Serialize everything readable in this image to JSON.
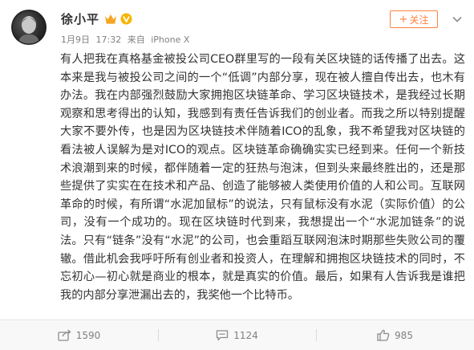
{
  "author": {
    "name": "徐小平",
    "post_date": "1月9日",
    "post_time": "17:32",
    "source_prefix": "来自",
    "source_device": "iPhone X"
  },
  "header": {
    "follow_label": "关注",
    "follow_plus": "+"
  },
  "post": {
    "text": "有人把我在真格基金被投公司CEO群里写的一段有关区块链的话传播了出去。这本来是我与被投公司之间的一个“低调”内部分享，现在被人擅自传出去，也木有办法。我在内部强烈鼓励大家拥抱区块链革命、学习区块链技术，是我经过长期观察和思考得出的认知，我感到有责任告诉我们的创业者。而我之所以特别提醒大家不要外传，也是因为区块链技术伴随着ICO的乱象，我不希望我对区块链的看法被人误解为是对ICO的观点。区块链革命确确实实已经到来。任何一个新技术浪潮到来的时候，都伴随着一定的狂热与泡沫，但到头来最终胜出的，还是那些提供了实实在在技术和产品、创造了能够被人类使用价值的人和公司。互联网革命的时候，有所谓“水泥加鼠标”的说法，只有鼠标没有水泥（实际价值）的公司，没有一个成功的。现在区块链时代到来，我想提出一个“水泥加链条”的说法。只有“链条”没有“水泥”的公司，也会重蹈互联网泡沫时期那些失败公司的覆辙。借此机会我呼吁所有创业者和投资人，在理解和拥抱区块链技术的同时，不忘初心—初心就是商业的根本，就是真实的价值。最后，如果有人告诉我是谁把我的内部分享泄漏出去的，我奖他一个比特币。"
  },
  "actions": {
    "share_count": "1590",
    "comment_count": "1124",
    "like_count": "985"
  },
  "colors": {
    "follow_accent": "#ff8140",
    "vip_gold": "#f5a623",
    "verify_gold": "#f7b500",
    "meta_gray": "#808080",
    "action_bg": "#f8f8f8"
  },
  "icons": {
    "vip": "vip-crown-icon",
    "verify": "verified-v-icon",
    "share": "share-icon",
    "comment": "comment-icon",
    "like": "thumbs-up-icon",
    "more": "chevron-down-icon"
  }
}
